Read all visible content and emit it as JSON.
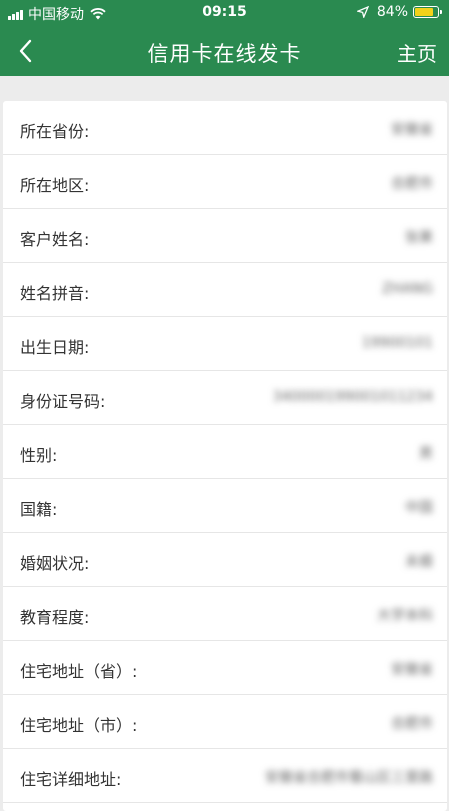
{
  "status_bar": {
    "carrier": "中国移动",
    "time": "09:15",
    "battery_percent": "84%",
    "battery_level": 0.84,
    "battery_color": "#f2d21a",
    "wifi_icon": "wifi-icon",
    "location_icon": "location-arrow-icon"
  },
  "nav": {
    "title": "信用卡在线发卡",
    "home_label": "主页",
    "back_icon": "chevron-left-icon",
    "background": "#2a8a50"
  },
  "form": {
    "rows": [
      {
        "label": "所在省份:",
        "value": "安徽省"
      },
      {
        "label": "所在地区:",
        "value": "合肥市"
      },
      {
        "label": "客户姓名:",
        "value": "张果"
      },
      {
        "label": "姓名拼音:",
        "value": "ZHANG"
      },
      {
        "label": "出生日期:",
        "value": "19900101"
      },
      {
        "label": "身份证号码:",
        "value": "340000199001011234"
      },
      {
        "label": "性别:",
        "value": "男"
      },
      {
        "label": "国籍:",
        "value": "中国"
      },
      {
        "label": "婚姻状况:",
        "value": "未婚"
      },
      {
        "label": "教育程度:",
        "value": "大学本科"
      },
      {
        "label": "住宅地址（省）:",
        "value": "安徽省"
      },
      {
        "label": "住宅地址（市）:",
        "value": "合肥市"
      },
      {
        "label": "住宅详细地址:",
        "value": "安徽省合肥市蜀山区三里路"
      }
    ]
  }
}
